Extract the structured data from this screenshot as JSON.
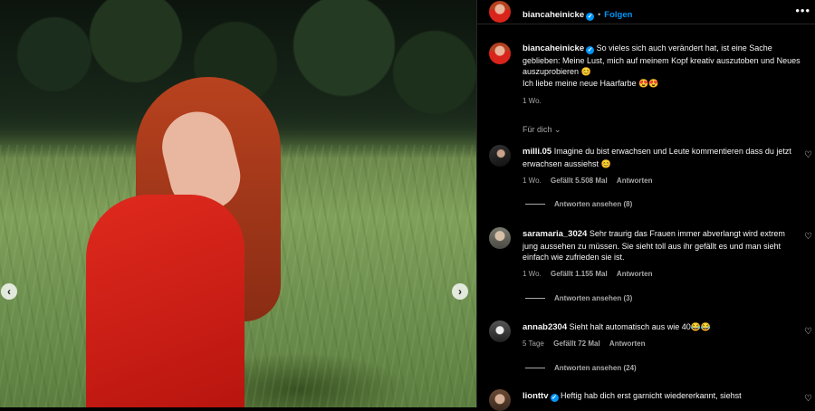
{
  "post": {
    "username": "biancaheinicke",
    "follow_label": "Folgen",
    "more_icon": "•••",
    "caption_line1": "So vieles sich auch verändert hat, ist eine Sache geblieben: Meine Lust, mich auf meinem Kopf kreativ auszutoben und Neues auszuprobieren 😊",
    "caption_line2": "Ich liebe meine neue Haarfarbe 😍😍",
    "time": "1 Wo.",
    "sort_label": "Für dich"
  },
  "carousel": {
    "prev_icon": "‹",
    "next_icon": "›"
  },
  "comments": [
    {
      "username": "milli.05",
      "verified": false,
      "text": "Imagine du bist erwachsen und Leute kommentieren dass du jetzt erwachsen aussiehst 😊",
      "time": "1 Wo.",
      "likes": "Gefällt 5.508 Mal",
      "reply": "Antworten",
      "replies": "Antworten ansehen (8)"
    },
    {
      "username": "saramaria_3024",
      "verified": false,
      "text": "Sehr traurig das Frauen immer abverlangt wird extrem jung aussehen zu müssen. Sie sieht toll aus ihr gefällt es und man sieht einfach wie zufrieden sie ist.",
      "time": "1 Wo.",
      "likes": "Gefällt 1.155 Mal",
      "reply": "Antworten",
      "replies": "Antworten ansehen (3)"
    },
    {
      "username": "annab2304",
      "verified": false,
      "text": "Sieht halt automatisch aus wie 40😂😂",
      "time": "5 Tage",
      "likes": "Gefällt 72 Mal",
      "reply": "Antworten",
      "replies": "Antworten ansehen (24)"
    },
    {
      "username": "lionttv",
      "verified": true,
      "text": "Heftig hab dich erst garnicht wiedererkannt, siehst",
      "time": "",
      "likes": "",
      "reply": "",
      "replies": ""
    }
  ],
  "icons": {
    "heart": "♡",
    "chevron": "⌄",
    "verified": "✓"
  }
}
